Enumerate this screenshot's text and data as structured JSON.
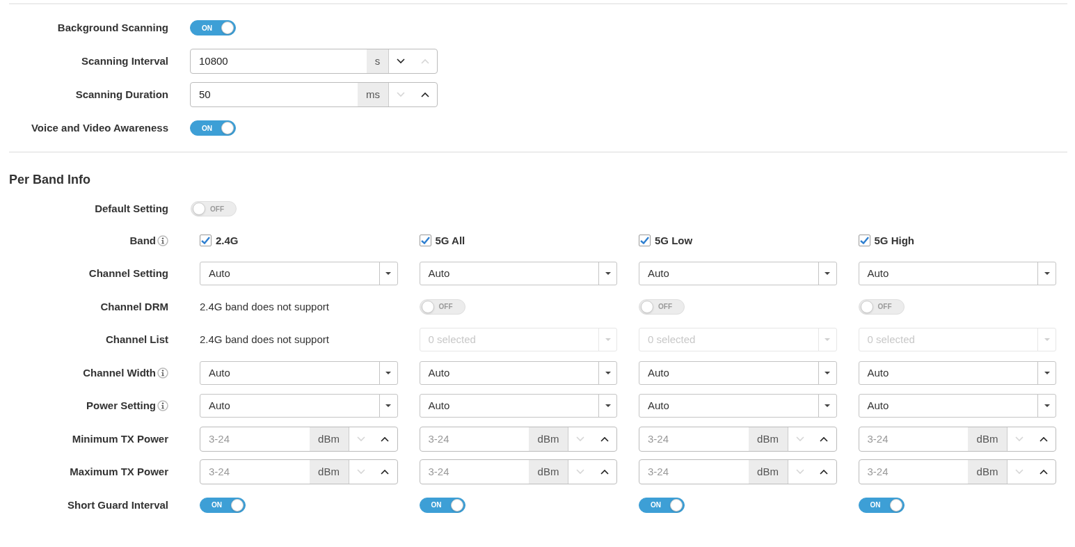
{
  "general": [
    {
      "kind": "toggle",
      "label": "Background Scanning",
      "on": true,
      "text": "ON"
    },
    {
      "kind": "spinner",
      "label": "Scanning Interval",
      "value": "10800",
      "unit": "s",
      "down_enabled": true,
      "up_enabled": false
    },
    {
      "kind": "spinner",
      "label": "Scanning Duration",
      "value": "50",
      "unit": "ms",
      "down_enabled": false,
      "up_enabled": true
    },
    {
      "kind": "toggle",
      "label": "Voice and Video Awareness",
      "on": true,
      "text": "ON"
    }
  ],
  "per_band": {
    "title": "Per Band Info",
    "default_setting": {
      "label": "Default Setting",
      "on": false,
      "text": "OFF"
    },
    "rows": [
      {
        "label": "Band",
        "info": true,
        "cells": [
          {
            "kind": "checkbox",
            "label": "2.4G",
            "checked": true
          },
          {
            "kind": "checkbox",
            "label": "5G All",
            "checked": true
          },
          {
            "kind": "checkbox",
            "label": "5G Low",
            "checked": true
          },
          {
            "kind": "checkbox",
            "label": "5G High",
            "checked": true
          }
        ]
      },
      {
        "label": "Channel Setting",
        "info": false,
        "cells": [
          {
            "kind": "dropdown",
            "value": "Auto",
            "disabled": false
          },
          {
            "kind": "dropdown",
            "value": "Auto",
            "disabled": false
          },
          {
            "kind": "dropdown",
            "value": "Auto",
            "disabled": false
          },
          {
            "kind": "dropdown",
            "value": "Auto",
            "disabled": false
          }
        ]
      },
      {
        "label": "Channel DRM",
        "info": false,
        "cells": [
          {
            "kind": "text",
            "text": "2.4G band does not support"
          },
          {
            "kind": "toggle",
            "on": false,
            "text": "OFF"
          },
          {
            "kind": "toggle",
            "on": false,
            "text": "OFF"
          },
          {
            "kind": "toggle",
            "on": false,
            "text": "OFF"
          }
        ]
      },
      {
        "label": "Channel List",
        "info": false,
        "cells": [
          {
            "kind": "text",
            "text": "2.4G band does not support"
          },
          {
            "kind": "dropdown",
            "value": "0 selected",
            "disabled": true
          },
          {
            "kind": "dropdown",
            "value": "0 selected",
            "disabled": true
          },
          {
            "kind": "dropdown",
            "value": "0 selected",
            "disabled": true
          }
        ]
      },
      {
        "label": "Channel Width",
        "info": true,
        "cells": [
          {
            "kind": "dropdown",
            "value": "Auto",
            "disabled": false
          },
          {
            "kind": "dropdown",
            "value": "Auto",
            "disabled": false
          },
          {
            "kind": "dropdown",
            "value": "Auto",
            "disabled": false
          },
          {
            "kind": "dropdown",
            "value": "Auto",
            "disabled": false
          }
        ]
      },
      {
        "label": "Power Setting",
        "info": true,
        "cells": [
          {
            "kind": "dropdown",
            "value": "Auto",
            "disabled": false
          },
          {
            "kind": "dropdown",
            "value": "Auto",
            "disabled": false
          },
          {
            "kind": "dropdown",
            "value": "Auto",
            "disabled": false
          },
          {
            "kind": "dropdown",
            "value": "Auto",
            "disabled": false
          }
        ]
      },
      {
        "label": "Minimum TX Power",
        "info": false,
        "cells": [
          {
            "kind": "spinner",
            "placeholder": "3-24",
            "unit": "dBm",
            "down_enabled": false,
            "up_enabled": true
          },
          {
            "kind": "spinner",
            "placeholder": "3-24",
            "unit": "dBm",
            "down_enabled": false,
            "up_enabled": true
          },
          {
            "kind": "spinner",
            "placeholder": "3-24",
            "unit": "dBm",
            "down_enabled": false,
            "up_enabled": true
          },
          {
            "kind": "spinner",
            "placeholder": "3-24",
            "unit": "dBm",
            "down_enabled": false,
            "up_enabled": true
          }
        ]
      },
      {
        "label": "Maximum TX Power",
        "info": false,
        "cells": [
          {
            "kind": "spinner",
            "placeholder": "3-24",
            "unit": "dBm",
            "down_enabled": false,
            "up_enabled": true
          },
          {
            "kind": "spinner",
            "placeholder": "3-24",
            "unit": "dBm",
            "down_enabled": false,
            "up_enabled": true
          },
          {
            "kind": "spinner",
            "placeholder": "3-24",
            "unit": "dBm",
            "down_enabled": false,
            "up_enabled": true
          },
          {
            "kind": "spinner",
            "placeholder": "3-24",
            "unit": "dBm",
            "down_enabled": false,
            "up_enabled": true
          }
        ]
      },
      {
        "label": "Short Guard Interval",
        "info": false,
        "cells": [
          {
            "kind": "toggle",
            "on": true,
            "text": "ON"
          },
          {
            "kind": "toggle",
            "on": true,
            "text": "ON"
          },
          {
            "kind": "toggle",
            "on": true,
            "text": "ON"
          },
          {
            "kind": "toggle",
            "on": true,
            "text": "ON"
          }
        ]
      }
    ]
  }
}
